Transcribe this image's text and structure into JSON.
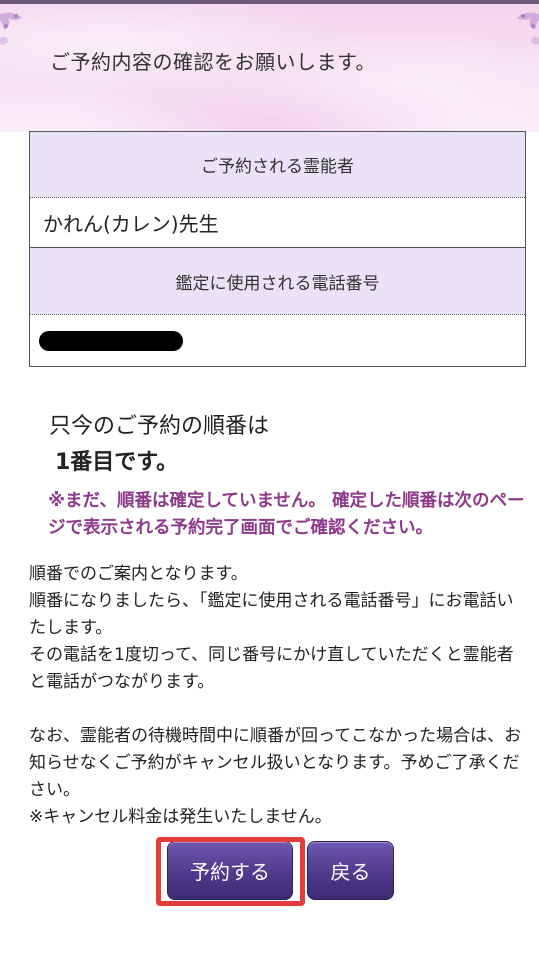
{
  "header": {
    "title": "ご予約内容の確認をお願いします。"
  },
  "reservation": {
    "psychic_label": "ご予約される霊能者",
    "psychic_name": "かれん(カレン)先生",
    "phone_label": "鑑定に使用される電話番号"
  },
  "order": {
    "line1": "只今のご予約の順番は",
    "line2": "1番目です。"
  },
  "notice": {
    "text": "※まだ、順番は確定していません。 確定した順番は次のページで表示される予約完了画面でご確認ください。"
  },
  "body": {
    "paragraph1": "順番でのご案内となります。\n順番になりましたら、「鑑定に使用される電話番号」にお電話いたします。\nその電話を1度切って、同じ番号にかけ直していただくと霊能者と電話がつながります。",
    "paragraph2": "なお、霊能者の待機時間中に順番が回ってこなかった場合は、お知らせなくご予約がキャンセル扱いとなります。予めご了承ください。\n※キャンセル料金は発生いたしません。"
  },
  "buttons": {
    "reserve_label": "予約する",
    "back_label": "戻る"
  },
  "colors": {
    "accent": "#4f3a8c",
    "notice": "#8e3a8a",
    "header_bg": "#f4d6ee",
    "table_head_bg": "#eae2f7",
    "highlight": "#e63b3b"
  }
}
